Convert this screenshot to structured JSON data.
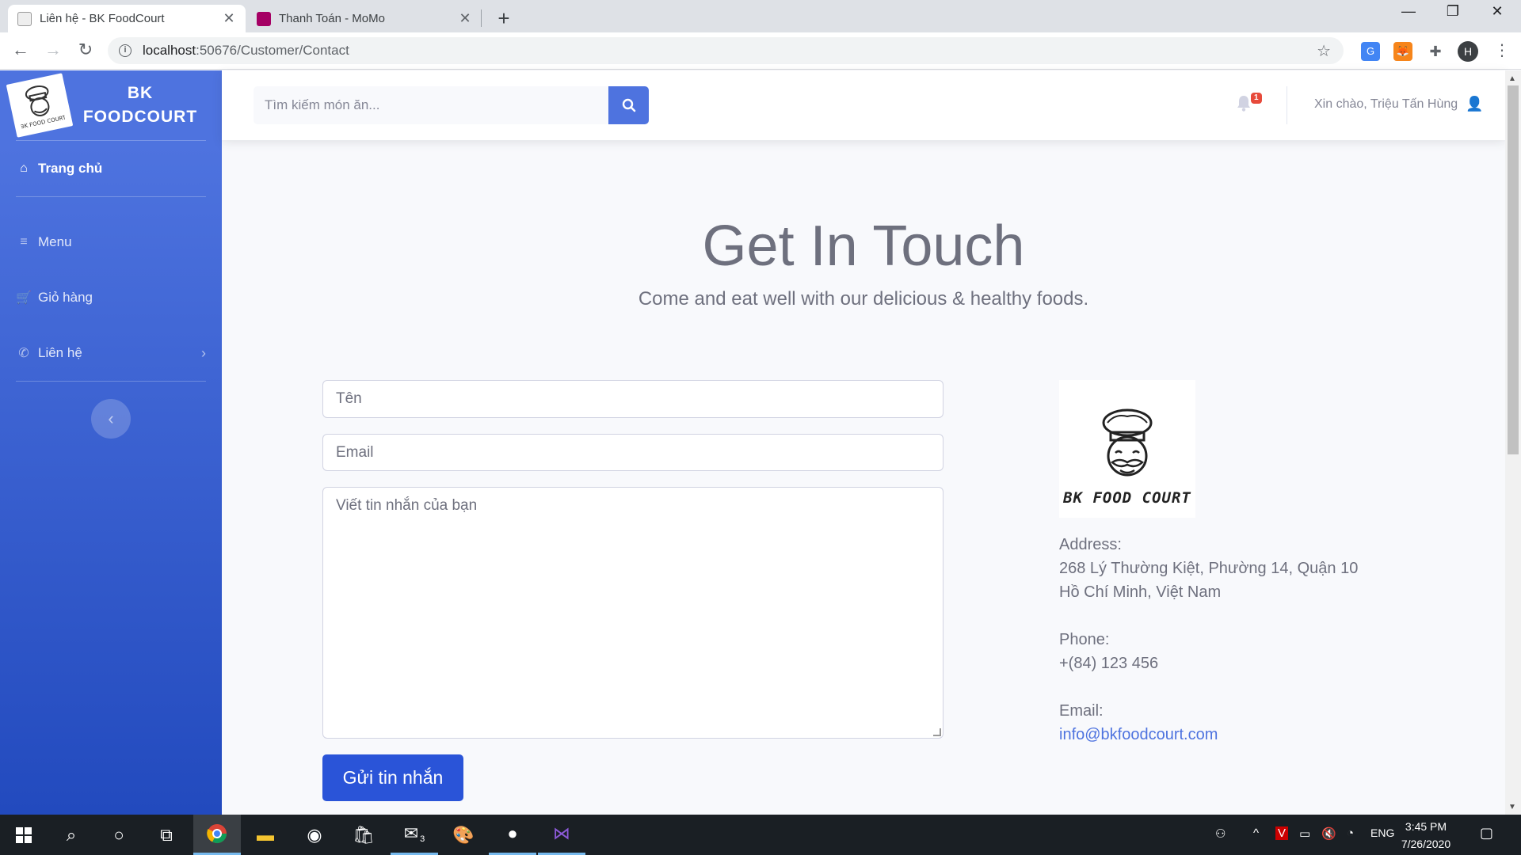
{
  "browser": {
    "tabs": [
      {
        "title": "Liên hệ - BK FoodCourt",
        "active": true
      },
      {
        "title": "Thanh Toán - MoMo",
        "active": false
      }
    ],
    "url_host": "localhost",
    "url_rest": ":50676/Customer/Contact",
    "profile_initial": "H"
  },
  "sidebar": {
    "brand_line1": "BK",
    "brand_line2": "FOODCOURT",
    "items": [
      {
        "label": "Trang chủ",
        "icon": "home-icon",
        "active": true
      },
      {
        "label": "Menu",
        "icon": "menu-icon",
        "active": false
      },
      {
        "label": "Giỏ hàng",
        "icon": "cart-icon",
        "active": false
      },
      {
        "label": "Liên hệ",
        "icon": "phone-icon",
        "active": false
      }
    ],
    "toggle_icon": "chevron-left-icon"
  },
  "topbar": {
    "search_placeholder": "Tìm kiếm món ăn...",
    "notification_count": "1",
    "greeting": "Xin chào, Triệu Tấn Hùng"
  },
  "main": {
    "title": "Get In Touch",
    "subtitle": "Come and eat well with our delicious & healthy foods.",
    "form": {
      "name_placeholder": "Tên",
      "email_placeholder": "Email",
      "message_placeholder": "Viết tin nhắn của bạn",
      "submit_label": "Gửi tin nhắn"
    },
    "contact": {
      "logo_text": "BK FOOD COURT",
      "address_label": "Address:",
      "address_line1": "268 Lý Thường Kiệt, Phường 14, Quận 10",
      "address_line2": "Hồ Chí Minh, Việt Nam",
      "phone_label": "Phone:",
      "phone": "+(84) 123 456",
      "email_label": "Email:",
      "email": "info@bkfoodcourt.com"
    }
  },
  "taskbar": {
    "language": "ENG",
    "time": "3:45 PM",
    "date": "7/26/2020",
    "mail_count": "3"
  },
  "colors": {
    "primary": "#4e73df",
    "sidebar_gradient_end": "#224abe",
    "text_muted": "#6e707e",
    "danger": "#e74a3b"
  }
}
